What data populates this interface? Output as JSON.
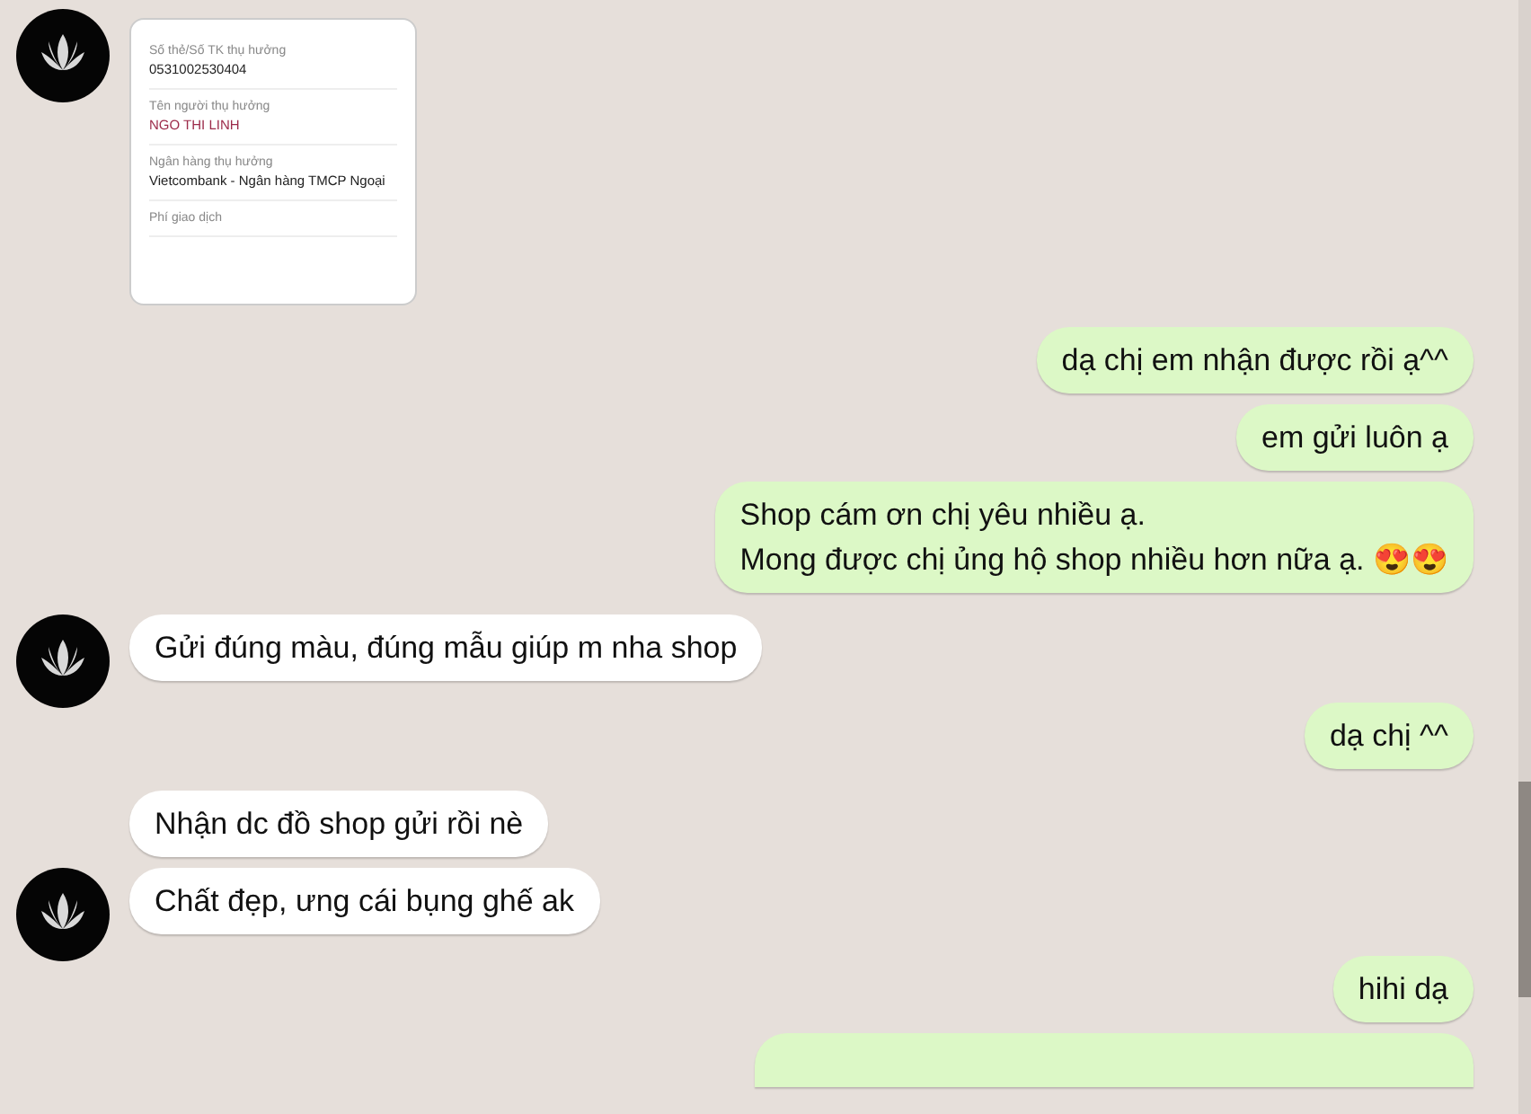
{
  "messages": [
    {
      "outgoing": false,
      "kind": "image",
      "avatar": true,
      "lines": [
        {
          "label": "Số thẻ/Số TK thụ hưởng",
          "value": "0531002530404"
        },
        {
          "label": "Tên người thụ hưởng",
          "value": "NGO THI LINH",
          "accent": true
        },
        {
          "label": "Ngân hàng thụ hưởng",
          "value": "Vietcombank - Ngân hàng TMCP Ngoại"
        },
        {
          "label": "Phí giao dịch"
        }
      ]
    },
    {
      "outgoing": true,
      "kind": "text",
      "text": "dạ chị em nhận được rồi ạ^^"
    },
    {
      "outgoing": true,
      "kind": "text",
      "text": "em gửi luôn ạ"
    },
    {
      "outgoing": true,
      "kind": "text",
      "text": "Shop cám ơn chị yêu nhiều ạ.\nMong được chị ủng hộ shop nhiều hơn nữa ạ. 😍😍"
    },
    {
      "outgoing": false,
      "kind": "text",
      "avatar": true,
      "text": "Gửi đúng màu, đúng mẫu giúp m nha shop"
    },
    {
      "outgoing": true,
      "kind": "text",
      "text": "dạ chị ^^"
    },
    {
      "outgoing": false,
      "kind": "text",
      "avatar": false,
      "text": "Nhận dc đồ shop gửi rồi nè"
    },
    {
      "outgoing": false,
      "kind": "text",
      "avatar": true,
      "text": "Chất đẹp, ưng cái bụng ghế ak"
    },
    {
      "outgoing": true,
      "kind": "text",
      "text": "hihi dạ"
    },
    {
      "outgoing": true,
      "kind": "cut"
    }
  ]
}
